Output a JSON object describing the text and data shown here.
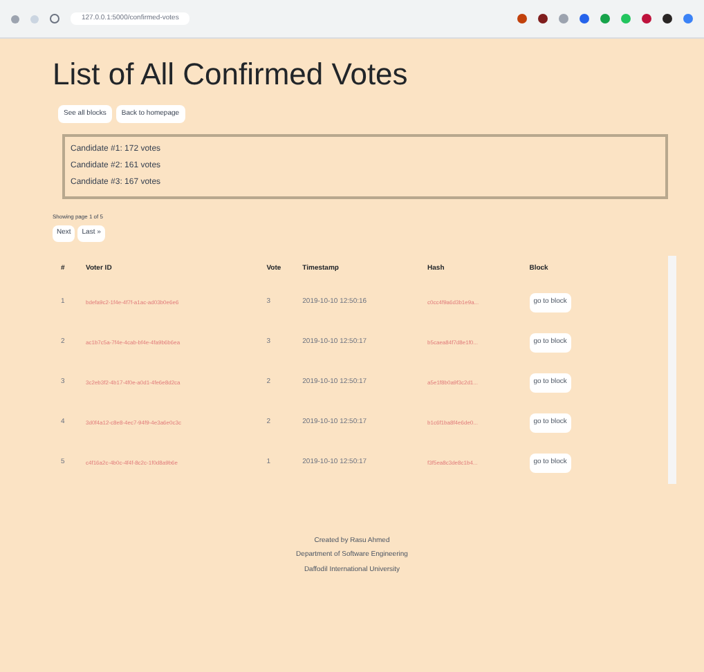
{
  "browser": {
    "url": "127.0.0.1:5000/confirmed-votes"
  },
  "title": "List of All Confirmed Votes",
  "nav_buttons": [
    "See all blocks",
    "Back to homepage"
  ],
  "tally": [
    "Candidate #1: 172 votes",
    "Candidate #2: 161 votes",
    "Candidate #3: 167 votes"
  ],
  "paging": {
    "status": "Showing page 1 of 5",
    "buttons": [
      "Next",
      "Last »"
    ]
  },
  "table": {
    "columns": [
      "#",
      "Voter ID",
      "Vote",
      "Timestamp",
      "Hash",
      "Block"
    ],
    "rows": [
      {
        "index": "1",
        "voter_id": "bdefa9c2-1f4e-4f7f-a1ac-ad03b0e6e6",
        "vote": "3",
        "timestamp": "2019-10-10 12:50:16",
        "hash": "c0cc4f9a6d3b1e9a...",
        "block": "go to block"
      },
      {
        "index": "2",
        "voter_id": "ac1b7c5a-7f4e-4cab-bf4e-4fa9b6b6ea",
        "vote": "3",
        "timestamp": "2019-10-10 12:50:17",
        "hash": "b5caea84f7d8e1f0...",
        "block": "go to block"
      },
      {
        "index": "3",
        "voter_id": "3c2eb3f2-4b17-4f0e-a0d1-4fe6e8d2ca",
        "vote": "2",
        "timestamp": "2019-10-10 12:50:17",
        "hash": "a5e1f8b0a9f3c2d1...",
        "block": "go to block"
      },
      {
        "index": "4",
        "voter_id": "3d0f4a12-c8e8-4ec7-94f9-4e3a6e0c3c",
        "vote": "2",
        "timestamp": "2019-10-10 12:50:17",
        "hash": "b1c6f1ba8f4e6de0...",
        "block": "go to block"
      },
      {
        "index": "5",
        "voter_id": "c4f16a2c-4b0c-4f4f-8c2c-1f0d8a9b6e",
        "vote": "1",
        "timestamp": "2019-10-10 12:50:17",
        "hash": "f3f5ea8c3de8c1b4...",
        "block": "go to block"
      }
    ]
  },
  "footer": [
    "Created by Rasu Ahmed",
    "Department of Software Engineering",
    "Daffodil International University"
  ]
}
